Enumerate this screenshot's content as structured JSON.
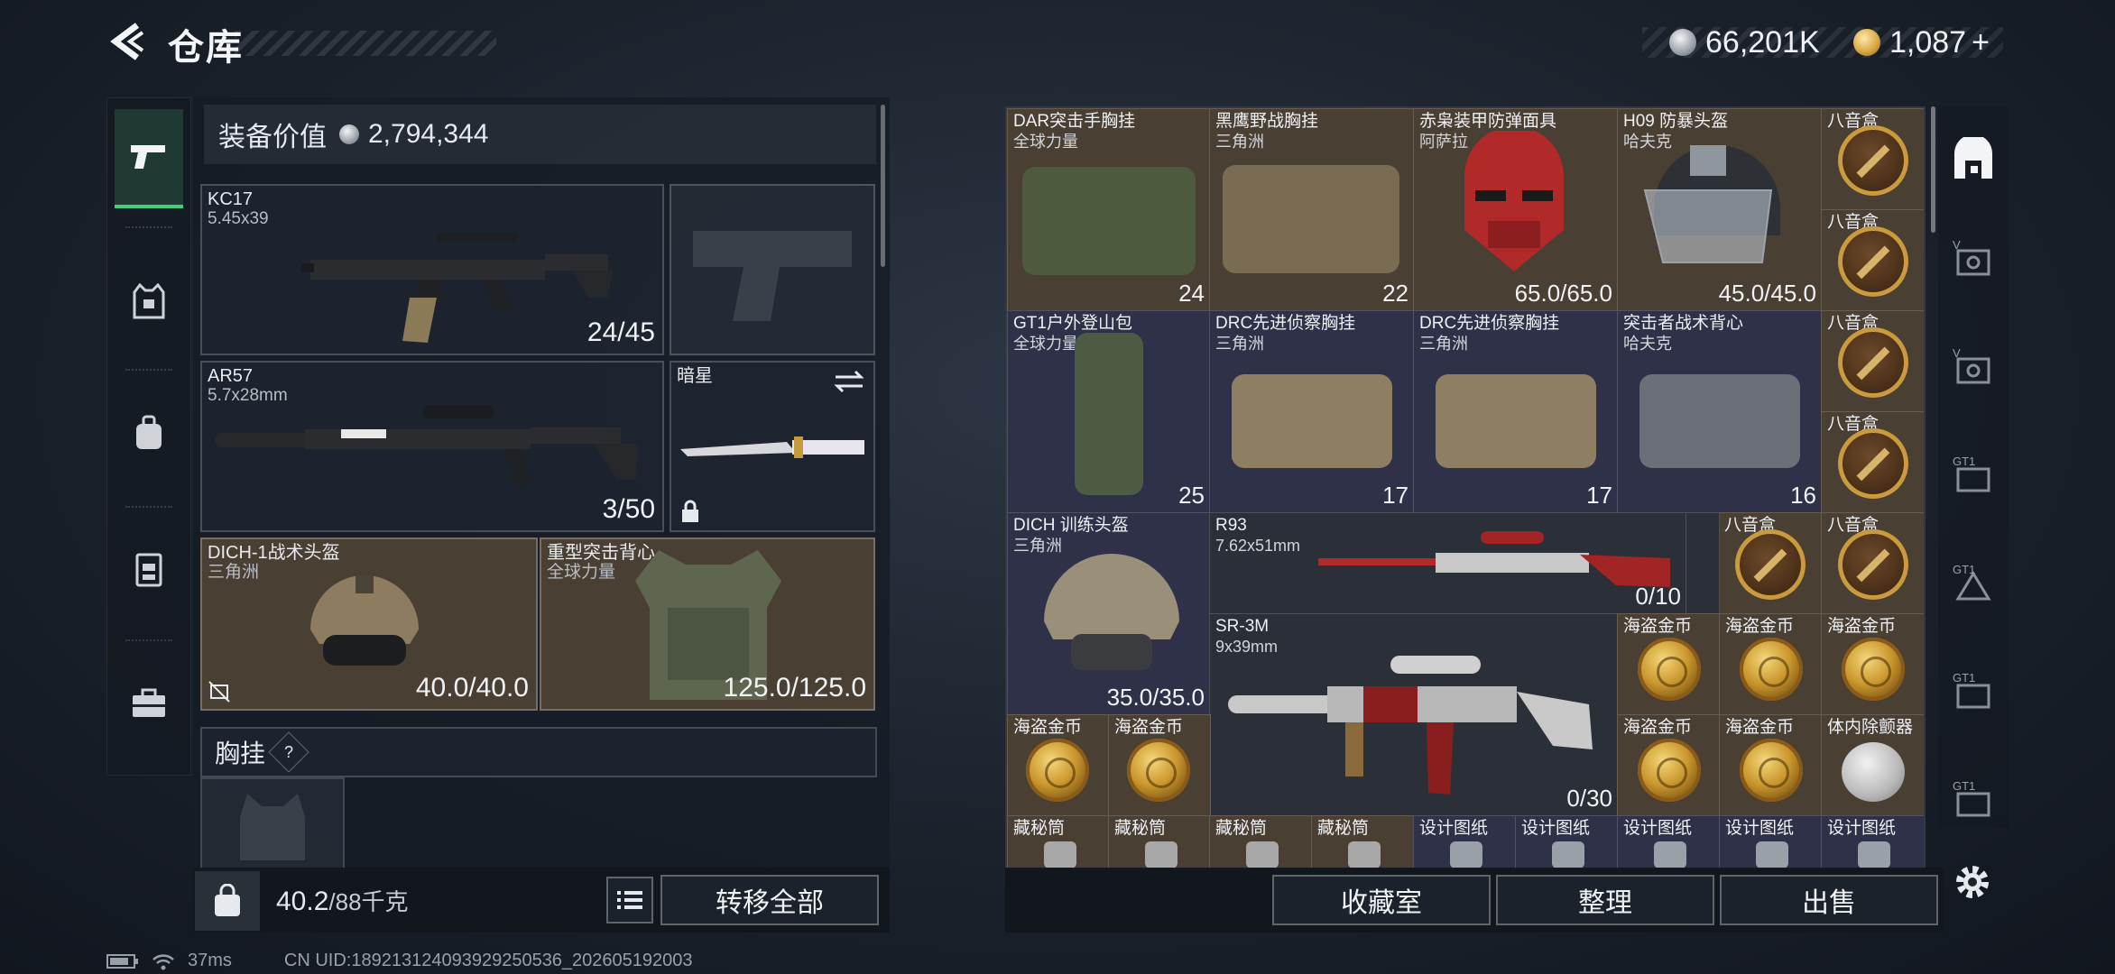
{
  "header": {
    "title": "仓库"
  },
  "currency": {
    "silver": "66,201K",
    "gold": "1,087",
    "plus": "+"
  },
  "equipment": {
    "value_label": "装备价值",
    "value": "2,794,344",
    "primary1": {
      "name": "KC17",
      "caliber": "5.45x39",
      "ammo": "24/45"
    },
    "primary2": {
      "name": "AR57",
      "caliber": "5.7x28mm",
      "ammo": "3/50"
    },
    "melee": {
      "name": "暗星"
    },
    "helmet": {
      "name": "DICH-1战术头盔",
      "faction": "三角洲",
      "durability": "40.0/40.0"
    },
    "armor": {
      "name": "重型突击背心",
      "faction": "全球力量",
      "durability": "125.0/125.0"
    },
    "chest_label": "胸挂",
    "chest_help": "?"
  },
  "footer": {
    "weight": "40.2",
    "weight_max": "/88千克",
    "transfer_all": "转移全部",
    "collection": "收藏室",
    "organize": "整理",
    "sell": "出售"
  },
  "inventory": {
    "items": [
      {
        "title": "DAR突击手胸挂",
        "sub": "全球力量",
        "value": "24"
      },
      {
        "title": "黑鹰野战胸挂",
        "sub": "三角洲",
        "value": "22"
      },
      {
        "title": "赤枭装甲防弹面具",
        "sub": "阿萨拉",
        "value": "65.0/65.0"
      },
      {
        "title": "H09 防暴头盔",
        "sub": "哈夫克",
        "value": "45.0/45.0"
      },
      {
        "title": "八音盒"
      },
      {
        "title": "八音盒"
      },
      {
        "title": "GT1户外登山包",
        "sub": "全球力量",
        "value": "25"
      },
      {
        "title": "DRC先进侦察胸挂",
        "sub": "三角洲",
        "value": "17"
      },
      {
        "title": "DRC先进侦察胸挂",
        "sub": "三角洲",
        "value": "17"
      },
      {
        "title": "突击者战术背心",
        "sub": "哈夫克",
        "value": "16"
      },
      {
        "title": "八音盒"
      },
      {
        "title": "八音盒"
      },
      {
        "title": "DICH 训练头盔",
        "sub": "三角洲",
        "value": "35.0/35.0"
      },
      {
        "title": "R93",
        "sub": "7.62x51mm",
        "value": "0/10"
      },
      {
        "title": "八音盒"
      },
      {
        "title": "八音盒"
      },
      {
        "title": "SR-3M",
        "sub": "9x39mm",
        "value": "0/30"
      },
      {
        "title": "海盗金币"
      },
      {
        "title": "海盗金币"
      },
      {
        "title": "海盗金币"
      },
      {
        "title": "海盗金币"
      },
      {
        "title": "海盗金币"
      },
      {
        "title": "海盗金币"
      },
      {
        "title": "海盗金币"
      },
      {
        "title": "体内除颤器"
      },
      {
        "title": "藏秘筒"
      },
      {
        "title": "藏秘筒"
      },
      {
        "title": "藏秘筒"
      },
      {
        "title": "藏秘筒"
      },
      {
        "title": "设计图纸"
      },
      {
        "title": "设计图纸"
      },
      {
        "title": "设计图纸"
      },
      {
        "title": "设计图纸"
      },
      {
        "title": "设计图纸"
      }
    ]
  },
  "right_nav": [
    {
      "label": ""
    },
    {
      "label": "V"
    },
    {
      "label": "V"
    },
    {
      "label": "GT1"
    },
    {
      "label": "GT1"
    },
    {
      "label": "GT1"
    },
    {
      "label": "GT1"
    }
  ],
  "status": {
    "ping": "37ms",
    "uid": "CN UID:18921312409392925053​6_202605192003"
  },
  "colors": {
    "accent_green": "#3fd07c",
    "slot_brown": "#4a3f33",
    "slot_navy": "#2f3149"
  }
}
